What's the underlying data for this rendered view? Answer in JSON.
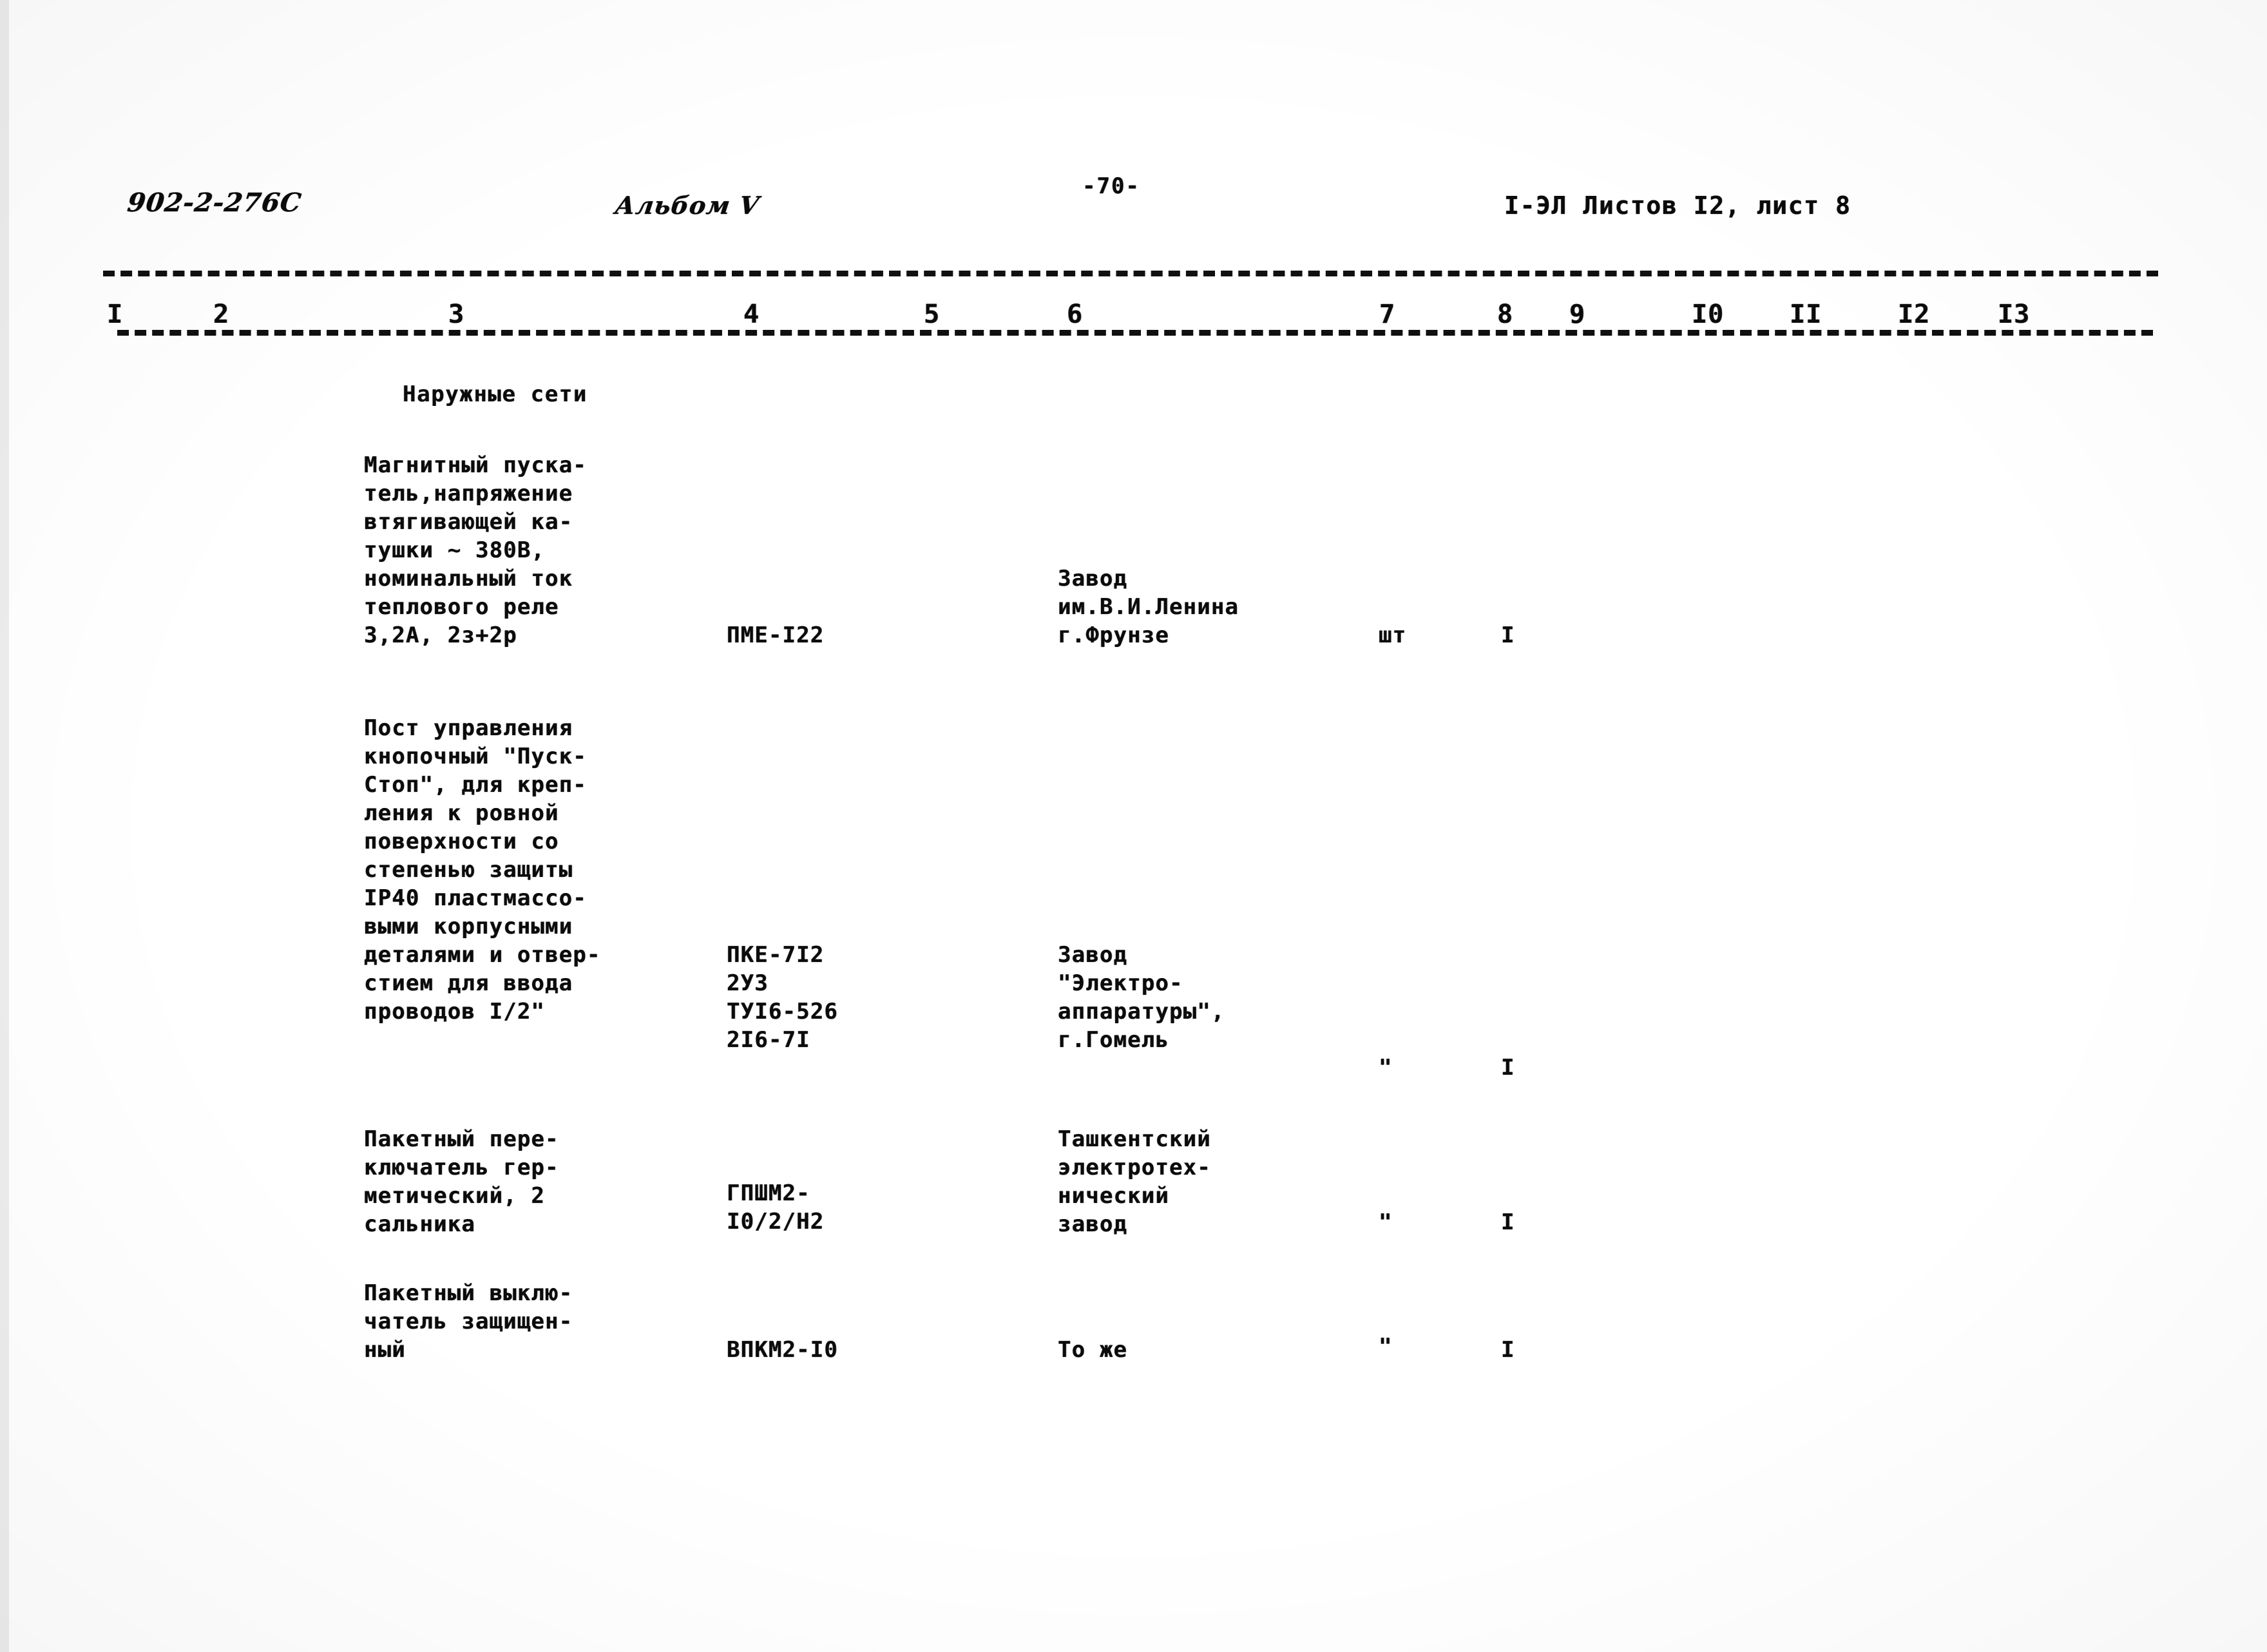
{
  "header": {
    "doc_code": "902-2-276С",
    "album": "Альбом V",
    "page_number": "-70-",
    "sheet_ref": "I-ЭЛ Листов I2, лист 8"
  },
  "table": {
    "column_numbers": [
      "I",
      "2",
      "3",
      "4",
      "5",
      "6",
      "7",
      "8",
      "9",
      "I0",
      "II",
      "I2",
      "I3"
    ],
    "section_caption": "Наружные сети",
    "rows": [
      {
        "name": "Магнитный пуска-\nтель,напряжение\nвтягивающей ка-\nтушки ~ 380В,\nноминальный ток\nтеплового реле\n3,2А, 2з+2р",
        "type": "ПМЕ-I22",
        "manufacturer": "Завод\nим.В.И.Ленина\nг.Фрунзе",
        "unit": "шт",
        "quantity": "I"
      },
      {
        "name": "Пост управления\nкнопочный \"Пуск-\nСтоп\", для креп-\nления к ровной\nповерхности со\nстепенью защиты\nIР40 пластмассо-\nвыми корпусными\nдеталями и отвер-\nстием для ввода\nпроводов I/2\"",
        "type": "ПКЕ-7I2\n 2У3\nТУI6-526\n2I6-7I",
        "manufacturer": "Завод\n\"Электро-\nаппаратуры\",\nг.Гомель",
        "unit": "\"",
        "quantity": "I"
      },
      {
        "name": "Пакетный пере-\nключатель гер-\nметический, 2\nсальника",
        "type": "ГПШМ2-\nI0/2/Н2",
        "manufacturer": "Ташкентский\nэлектротех-\nнический\n завод",
        "unit": "\"",
        "quantity": "I"
      },
      {
        "name": "Пакетный выклю-\nчатель защищен-\nный",
        "type": "ВПКМ2-I0",
        "manufacturer": "То же",
        "unit": "\"",
        "quantity": "I"
      }
    ]
  }
}
